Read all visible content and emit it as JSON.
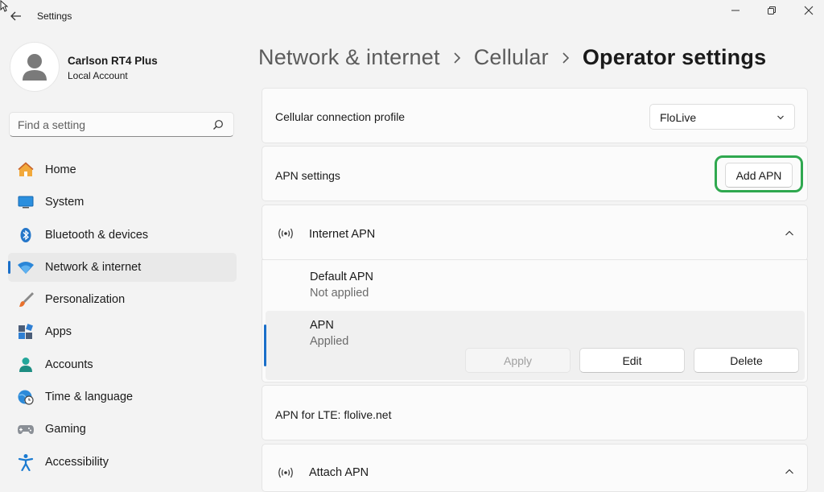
{
  "window": {
    "title": "Settings"
  },
  "user": {
    "name": "Carlson RT4 Plus",
    "account_type": "Local Account"
  },
  "search": {
    "placeholder": "Find a setting"
  },
  "sidebar": {
    "items": [
      {
        "label": "Home",
        "icon": "home-icon"
      },
      {
        "label": "System",
        "icon": "system-icon"
      },
      {
        "label": "Bluetooth & devices",
        "icon": "bluetooth-icon"
      },
      {
        "label": "Network & internet",
        "icon": "wifi-icon",
        "active": true
      },
      {
        "label": "Personalization",
        "icon": "brush-icon"
      },
      {
        "label": "Apps",
        "icon": "apps-icon"
      },
      {
        "label": "Accounts",
        "icon": "accounts-icon"
      },
      {
        "label": "Time & language",
        "icon": "globe-clock-icon"
      },
      {
        "label": "Gaming",
        "icon": "gamepad-icon"
      },
      {
        "label": "Accessibility",
        "icon": "accessibility-icon"
      }
    ]
  },
  "breadcrumb": {
    "items": [
      "Network & internet",
      "Cellular",
      "Operator settings"
    ]
  },
  "cellular_profile": {
    "label": "Cellular connection profile",
    "selected": "FloLive"
  },
  "apn_settings": {
    "label": "APN settings",
    "add_button": "Add APN"
  },
  "internet_apn": {
    "label": "Internet APN",
    "entries": [
      {
        "name": "Default APN",
        "status": "Not applied"
      },
      {
        "name": "APN",
        "status": "Applied"
      }
    ],
    "actions": {
      "apply": "Apply",
      "edit": "Edit",
      "delete": "Delete"
    }
  },
  "lte_apn": {
    "label": "APN for LTE: flolive.net"
  },
  "attach_apn": {
    "label": "Attach APN"
  },
  "colors": {
    "accent": "#1a6fc9",
    "highlight": "#2fa84f",
    "background": "#f3f3f3",
    "card": "#fbfbfb"
  }
}
